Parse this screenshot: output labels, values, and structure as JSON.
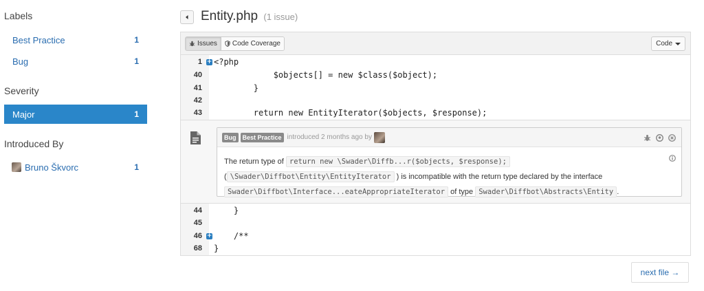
{
  "sidebar": {
    "labels_title": "Labels",
    "labels": [
      {
        "label": "Best Practice",
        "count": "1"
      },
      {
        "label": "Bug",
        "count": "1"
      }
    ],
    "severity_title": "Severity",
    "severity": [
      {
        "label": "Major",
        "count": "1"
      }
    ],
    "introduced_title": "Introduced By",
    "introduced": [
      {
        "label": "Bruno Škvorc",
        "count": "1"
      }
    ]
  },
  "header": {
    "file_name": "Entity.php",
    "issue_count": "(1 issue)"
  },
  "toolbar": {
    "issues_label": "Issues",
    "coverage_label": "Code Coverage",
    "code_label": "Code"
  },
  "code_top": [
    {
      "num": "1",
      "code": "<?php",
      "expandable": true
    },
    {
      "num": "40",
      "code": "            $objects[] = new $class($object);"
    },
    {
      "num": "41",
      "code": "        }"
    },
    {
      "num": "42",
      "code": ""
    },
    {
      "num": "43",
      "code": "        return new EntityIterator($objects, $response);"
    }
  ],
  "issue": {
    "badge_bug": "Bug",
    "badge_practice": "Best Practice",
    "meta": "introduced 2 months ago by",
    "text1": "The return type of",
    "code1": "return new \\Swader\\Diffb...r($objects, $response);",
    "code2": "\\Swader\\Diffbot\\Entity\\EntityIterator",
    "text2": ") is incompatible with the return type declared by the interface",
    "code3": "Swader\\Diffbot\\Interface...eateAppropriateIterator",
    "text3": "of type",
    "code4": "Swader\\Diffbot\\Abstracts\\Entity",
    "text4": ".",
    "open_paren": "("
  },
  "code_bottom": [
    {
      "num": "44",
      "code": "    }"
    },
    {
      "num": "45",
      "code": ""
    },
    {
      "num": "46",
      "code": "    /**",
      "expandable": true
    },
    {
      "num": "68",
      "code": "}"
    }
  ],
  "footer": {
    "next_label": "next file →"
  }
}
